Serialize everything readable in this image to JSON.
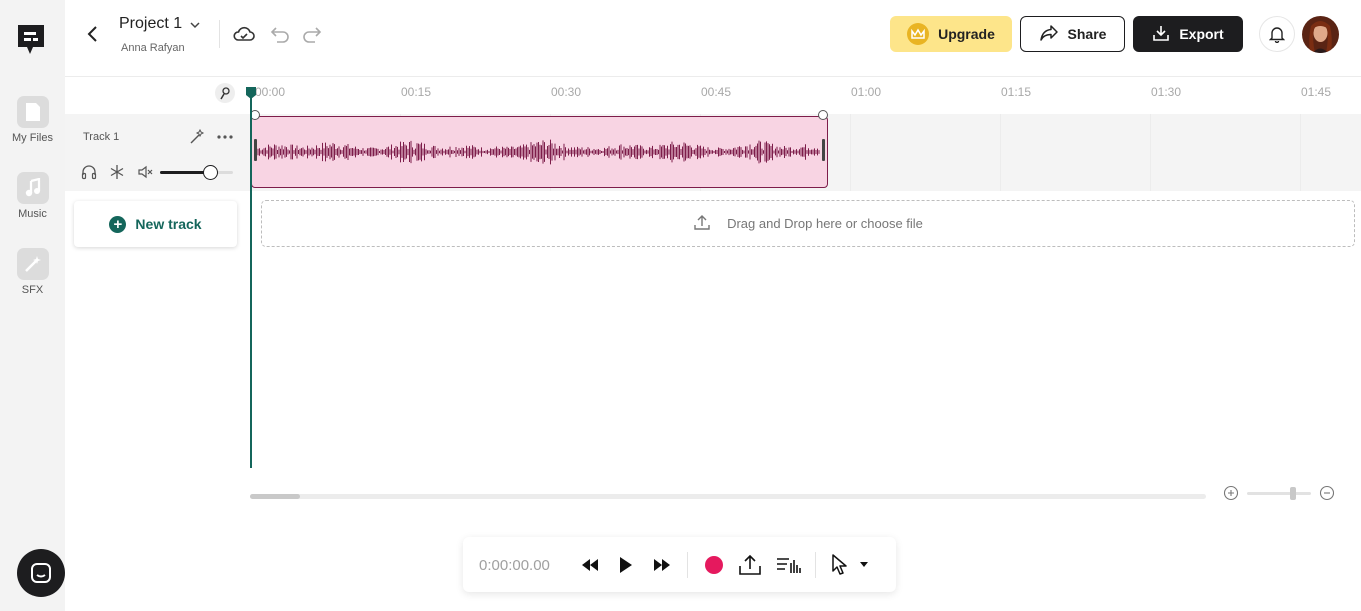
{
  "brand": {
    "logo_icon": "podcastle-logo-icon",
    "accent": "#14665b"
  },
  "sidebar": {
    "items": [
      {
        "label": "My Files",
        "icon": "file-icon"
      },
      {
        "label": "Music",
        "icon": "music-note-icon"
      },
      {
        "label": "SFX",
        "icon": "magic-wand-icon"
      }
    ],
    "chat_icon": "chat-icon"
  },
  "header": {
    "project_title": "Project 1",
    "project_owner": "Anna Rafyan",
    "upgrade_label": "Upgrade",
    "share_label": "Share",
    "export_label": "Export"
  },
  "ruler": {
    "ticks": [
      "00:00",
      "00:15",
      "00:30",
      "00:45",
      "01:00",
      "01:15",
      "01:30",
      "01:45"
    ]
  },
  "track": {
    "name": "Track 1",
    "volume": 0.68,
    "clip_color": "#f8d4e3",
    "waveform_color": "#7d1d4a"
  },
  "new_track_label": "New track",
  "drop_zone_label": "Drag and Drop here or choose file",
  "zoom": {
    "level": 0.72
  },
  "timeline_scroll": {
    "position": 0
  },
  "transport": {
    "timecode": "0:00:00.00",
    "record_color": "#e5195e"
  }
}
